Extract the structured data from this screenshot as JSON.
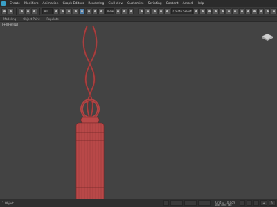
{
  "menu": {
    "items": [
      "Create",
      "Modifiers",
      "Animation",
      "Graph Editors",
      "Rendering",
      "Civil View",
      "Customize",
      "Scripting",
      "Content",
      "Arnold",
      "Help"
    ]
  },
  "toolbar": {
    "filter_dropdown": "All",
    "view_dropdown": "View",
    "selection_set_dropdown": "Create Selection Se"
  },
  "ribbon": {
    "tabs": [
      "Modeling",
      "Object Paint",
      "Populate"
    ]
  },
  "viewport": {
    "label": "[+][Persp]"
  },
  "status": {
    "selection": "1 Object",
    "grid": "Grid = 10,0cm",
    "add_time_tag": "Add Time Tag",
    "frame": "0"
  }
}
